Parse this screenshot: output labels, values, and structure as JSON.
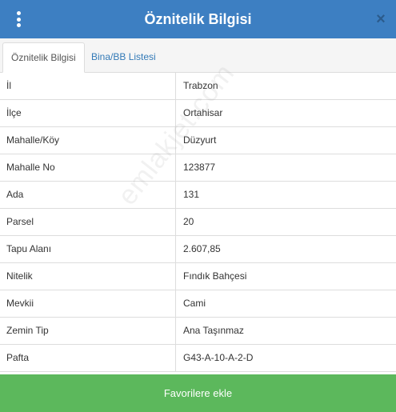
{
  "header": {
    "title": "Öznitelik Bilgisi",
    "menu_icon": "vertical-dots-icon",
    "close_icon": "close-icon",
    "close_glyph": "×"
  },
  "tabs": [
    {
      "label": "Öznitelik Bilgisi",
      "active": true
    },
    {
      "label": "Bina/BB Listesi",
      "active": false
    }
  ],
  "attributes": [
    {
      "label": "İl",
      "value": "Trabzon"
    },
    {
      "label": "İlçe",
      "value": "Ortahisar"
    },
    {
      "label": "Mahalle/Köy",
      "value": "Düzyurt"
    },
    {
      "label": "Mahalle No",
      "value": "123877"
    },
    {
      "label": "Ada",
      "value": "131"
    },
    {
      "label": "Parsel",
      "value": "20"
    },
    {
      "label": "Tapu Alanı",
      "value": "2.607,85"
    },
    {
      "label": "Nitelik",
      "value": "Fındık Bahçesi"
    },
    {
      "label": "Mevkii",
      "value": "Cami"
    },
    {
      "label": "Zemin Tip",
      "value": "Ana Taşınmaz"
    },
    {
      "label": "Pafta",
      "value": "G43-A-10-A-2-D"
    }
  ],
  "watermark": "emlakjet.com",
  "footer": {
    "favorite_label": "Favorilere ekle"
  },
  "colors": {
    "header": "#3d7fc2",
    "footer_button": "#5cb85c",
    "link": "#337ab7"
  }
}
